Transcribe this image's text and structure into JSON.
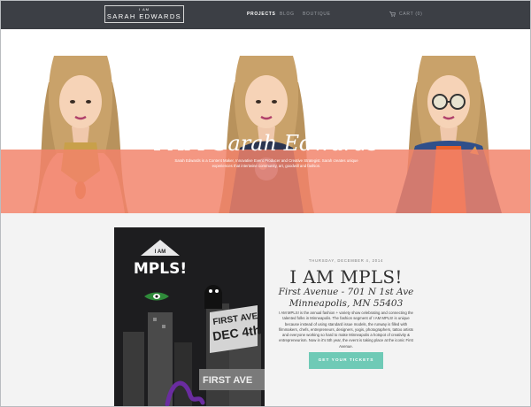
{
  "header": {
    "logo_small": "I AM",
    "logo_main": "SARAH EDWARDS",
    "nav": [
      {
        "label": "PROJECTS",
        "active": true
      },
      {
        "label": "BLOG",
        "active": false
      },
      {
        "label": "BOUTIQUE",
        "active": false
      }
    ],
    "cart_icon": "shopping-cart-icon",
    "cart_label": "CART (0)"
  },
  "hero": {
    "title": "I AM Sarah Edwards",
    "description": "Sarah Edwards is a Content Maker, Innovative Event Producer and Creative Strategist. Sarah creates unique experiences that intertwine community, art, goodwill and fashion.",
    "banner_color": "#f2836a"
  },
  "event": {
    "date": "THURSDAY, DECEMBER 4, 2014",
    "title": "I AM MPLS!",
    "venue": "First Avenue - 701 N 1st Ave Minneapolis, MN 55403",
    "description": "I AM MPLS! is the annual fashion + variety show celebrating and connecting the talented folks in Minneapolis. The fashion segment of I AM MPLS! is unique because instead of using standard issue models, the runway is filled with filmmakers, chefs, entrepreneurs, designers, yogis, photographers, tattoo artists and everyone working so hard to make Minneapolis a hotspot of creativity & entrepreneurism. Now in it's 5th year, the event is taking place at the iconic First Avenue.",
    "button_label": "GET YOUR TICKETS",
    "button_color": "#6fcab6",
    "poster": {
      "badge": "I AM",
      "headline": "MPLS!",
      "billboard_line1": "FIRST AVE",
      "billboard_line2": "DEC 4th",
      "marquee": "FIRST AVE"
    }
  },
  "colors": {
    "header_bg": "#3c3f45",
    "content_bg": "#f3f3f3"
  }
}
